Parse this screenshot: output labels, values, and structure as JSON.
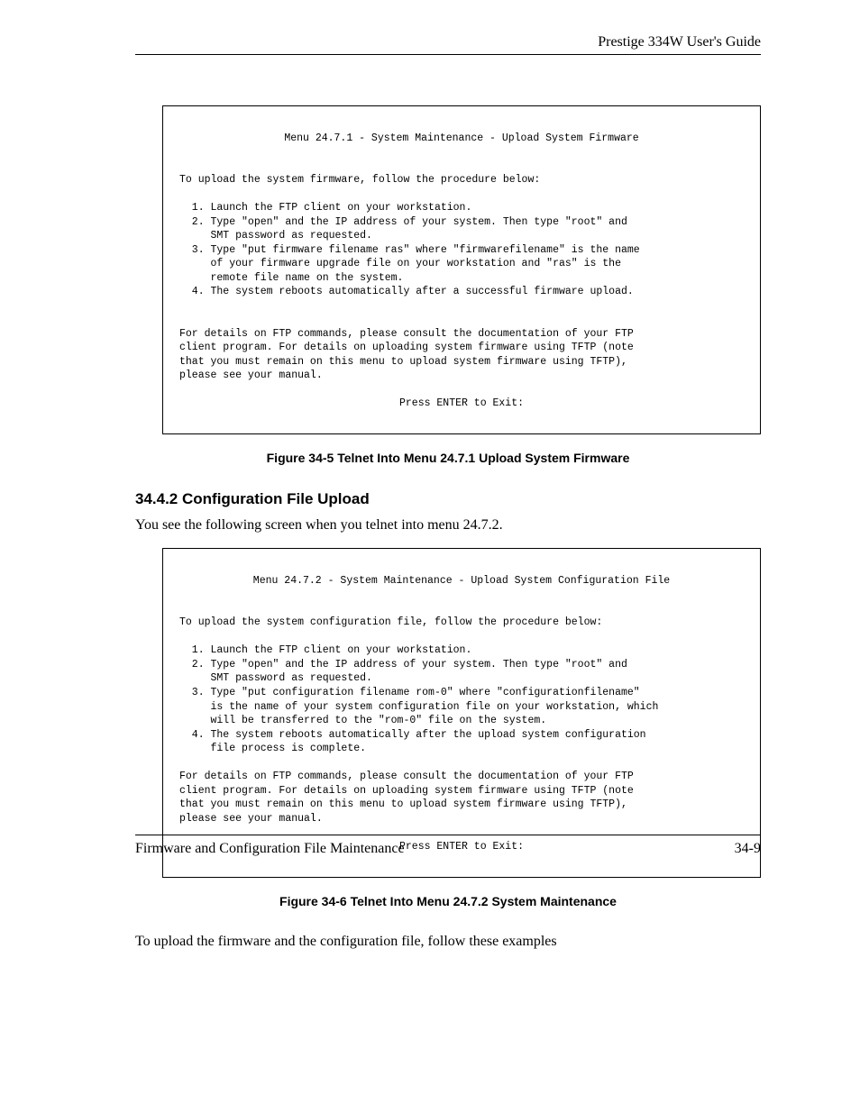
{
  "header": {
    "title": "Prestige 334W User's Guide"
  },
  "box1": {
    "title": "Menu 24.7.1 - System Maintenance - Upload System Firmware",
    "intro": "To upload the system firmware, follow the procedure below:",
    "step1": "  1. Launch the FTP client on your workstation.",
    "step2a": "  2. Type \"open\" and the IP address of your system. Then type \"root\" and",
    "step2b": "     SMT password as requested.",
    "step3a": "  3. Type \"put firmware filename ras\" where \"firmwarefilename\" is the name",
    "step3b": "     of your firmware upgrade file on your workstation and \"ras\" is the",
    "step3c": "     remote file name on the system.",
    "step4": "  4. The system reboots automatically after a successful firmware upload.",
    "d1": "For details on FTP commands, please consult the documentation of your FTP",
    "d2": "client program. For details on uploading system firmware using TFTP (note",
    "d3": "that you must remain on this menu to upload system firmware using TFTP),",
    "d4": "please see your manual.",
    "exit": "Press ENTER to Exit:"
  },
  "fig1": "Figure 34-5 Telnet Into Menu 24.7.1 Upload System Firmware",
  "sectionHeading": "34.4.2 Configuration File Upload",
  "sectionIntro": "You see the following screen when you telnet into menu 24.7.2.",
  "box2": {
    "title": "Menu 24.7.2 - System Maintenance - Upload System Configuration File",
    "intro": "To upload the system configuration file, follow the procedure below:",
    "step1": "  1. Launch the FTP client on your workstation.",
    "step2a": "  2. Type \"open\" and the IP address of your system. Then type \"root\" and",
    "step2b": "     SMT password as requested.",
    "step3a": "  3. Type \"put configuration filename rom-0\" where \"configurationfilename\"",
    "step3b": "     is the name of your system configuration file on your workstation, which",
    "step3c": "     will be transferred to the \"rom-0\" file on the system.",
    "step4a": "  4. The system reboots automatically after the upload system configuration",
    "step4b": "     file process is complete.",
    "d1": "For details on FTP commands, please consult the documentation of your FTP",
    "d2": "client program. For details on uploading system firmware using TFTP (note",
    "d3": "that you must remain on this menu to upload system firmware using TFTP),",
    "d4": "please see your manual.",
    "exit": "Press ENTER to Exit:"
  },
  "fig2": "Figure 34-6 Telnet Into Menu 24.7.2 System Maintenance",
  "closing": "To upload the firmware and the configuration file, follow these examples",
  "footer": {
    "left": "Firmware and Configuration File Maintenance",
    "right": "34-9"
  }
}
